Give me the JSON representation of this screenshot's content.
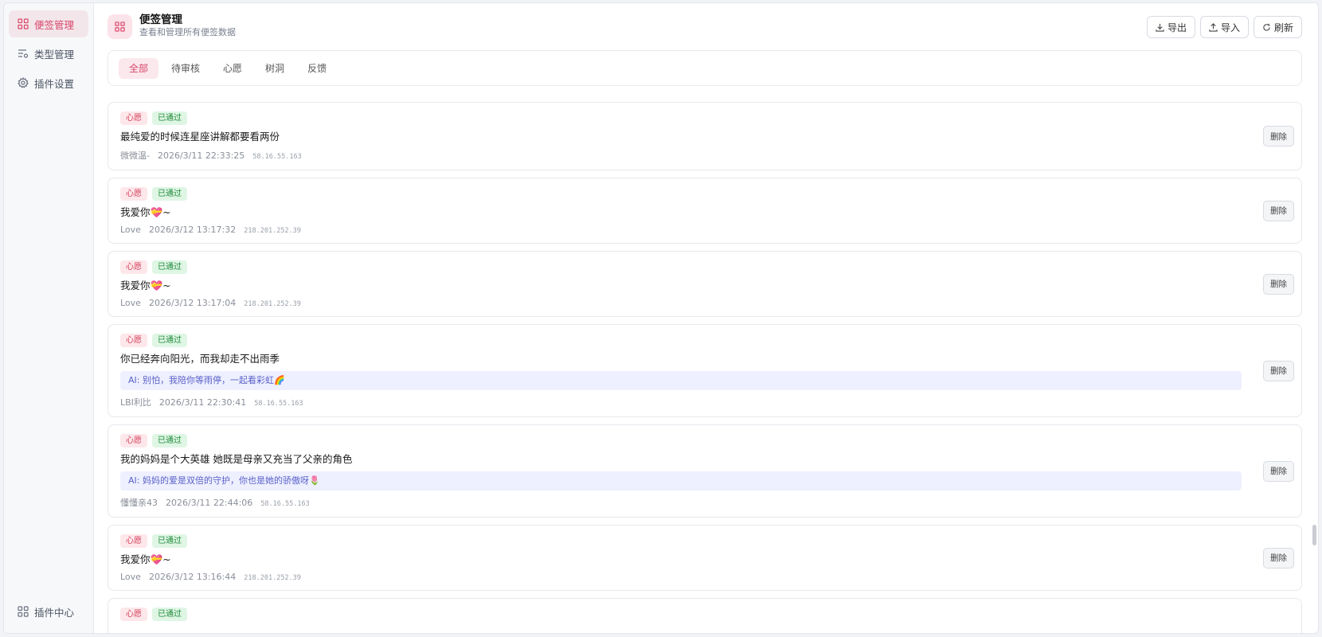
{
  "sidebar": {
    "items": [
      {
        "label": "便签管理",
        "icon": "grid-icon",
        "active": true
      },
      {
        "label": "类型管理",
        "icon": "list-settings-icon",
        "active": false
      },
      {
        "label": "插件设置",
        "icon": "gear-icon",
        "active": false
      }
    ],
    "bottom_item": {
      "label": "插件中心",
      "icon": "grid-icon"
    }
  },
  "header": {
    "title": "便签管理",
    "subtitle": "查看和管理所有便签数据",
    "actions": {
      "export": "导出",
      "import": "导入",
      "refresh": "刷新"
    }
  },
  "tabs": [
    {
      "label": "全部",
      "active": true
    },
    {
      "label": "待审核",
      "active": false
    },
    {
      "label": "心愿",
      "active": false
    },
    {
      "label": "树洞",
      "active": false
    },
    {
      "label": "反馈",
      "active": false
    }
  ],
  "delete_label": "删除",
  "notes": [
    {
      "type": "心愿",
      "status": "已通过",
      "content": "最纯爱的时候连星座讲解都要看两份",
      "ai": null,
      "author": "微微温-",
      "time": "2026/3/11 22:33:25",
      "ip": "58.16.55.163"
    },
    {
      "type": "心愿",
      "status": "已通过",
      "content": "我爱你💝~",
      "ai": null,
      "author": "Love",
      "time": "2026/3/12 13:17:32",
      "ip": "218.201.252.39"
    },
    {
      "type": "心愿",
      "status": "已通过",
      "content": "我爱你💝~",
      "ai": null,
      "author": "Love",
      "time": "2026/3/12 13:17:04",
      "ip": "218.201.252.39"
    },
    {
      "type": "心愿",
      "status": "已通过",
      "content": "你已经奔向阳光，而我却走不出雨季",
      "ai": "AI: 别怕，我陪你等雨停，一起看彩虹🌈",
      "author": "LBI利比",
      "time": "2026/3/11 22:30:41",
      "ip": "58.16.55.163"
    },
    {
      "type": "心愿",
      "status": "已通过",
      "content": "我的妈妈是个大英雄 她既是母亲又充当了父亲的角色",
      "ai": "AI: 妈妈的爱是双倍的守护，你也是她的骄傲呀🌷",
      "author": "懂懂亲43",
      "time": "2026/3/11 22:44:06",
      "ip": "58.16.55.163"
    },
    {
      "type": "心愿",
      "status": "已通过",
      "content": "我爱你💝~",
      "ai": null,
      "author": "Love",
      "time": "2026/3/12 13:16:44",
      "ip": "218.201.252.39"
    },
    {
      "type": "心愿",
      "status": "已通过",
      "content": "",
      "ai": null,
      "author": "",
      "time": "",
      "ip": ""
    }
  ],
  "colors": {
    "accent": "#d9466b",
    "accent_bg": "#fbe8ec",
    "success": "#1f8a3b",
    "ai_text": "#5960c8"
  }
}
